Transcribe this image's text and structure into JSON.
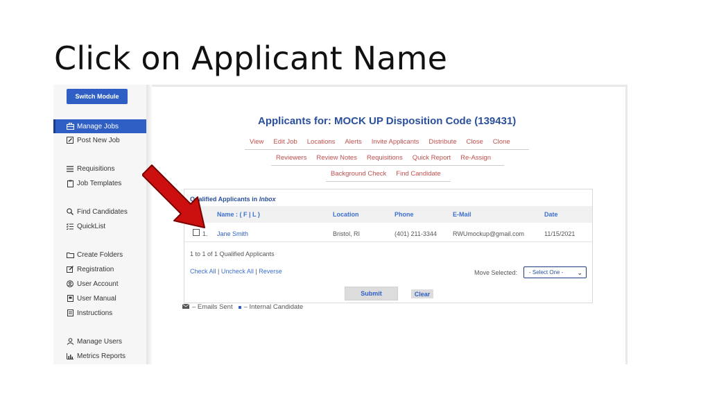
{
  "slide": {
    "title": "Click on Applicant Name"
  },
  "sidebar": {
    "switch_module": "Switch Module",
    "items": [
      {
        "label": "Manage Jobs",
        "icon": "briefcase-icon",
        "active": true
      },
      {
        "label": "Post New Job",
        "icon": "edit-icon",
        "active": false
      },
      {
        "label": "Requisitions",
        "icon": "list-icon",
        "active": false
      },
      {
        "label": "Job Templates",
        "icon": "clipboard-icon",
        "active": false
      },
      {
        "label": "Find Candidates",
        "icon": "search-icon",
        "active": false
      },
      {
        "label": "QuickList",
        "icon": "checklist-icon",
        "active": false
      },
      {
        "label": "Create Folders",
        "icon": "folder-icon",
        "active": false
      },
      {
        "label": "Registration",
        "icon": "edit-icon",
        "active": false
      },
      {
        "label": "User Account",
        "icon": "user-circle-icon",
        "active": false
      },
      {
        "label": "User Manual",
        "icon": "book-icon",
        "active": false
      },
      {
        "label": "Instructions",
        "icon": "document-icon",
        "active": false
      },
      {
        "label": "Manage Users",
        "icon": "users-icon",
        "active": false
      },
      {
        "label": "Metrics Reports",
        "icon": "bar-chart-icon",
        "active": false
      }
    ]
  },
  "header": {
    "title": "Applicants for: MOCK UP Disposition Code (139431)",
    "tabs_row1": [
      "View",
      "Edit Job",
      "Locations",
      "Alerts",
      "Invite Applicants",
      "Distribute",
      "Close",
      "Clone"
    ],
    "tabs_row2": [
      "Reviewers",
      "Review Notes",
      "Requisitions",
      "Quick Report",
      "Re-Assign"
    ],
    "tabs_row3": [
      "Background Check",
      "Find Candidate"
    ]
  },
  "panel": {
    "title_prefix": "Qualified Applicants in ",
    "title_folder": "Inbox",
    "columns": [
      "Name : ( F | L )",
      "Location",
      "Phone",
      "E-Mail",
      "Date"
    ],
    "rows": [
      {
        "num": "1.",
        "name": "Jane Smith",
        "location": "Bristol, RI",
        "phone": "(401) 211-3344",
        "email": "RWUmockup@gmail.com",
        "date": "11/15/2021"
      }
    ],
    "count_text": "1 to 1 of 1 Qualified Applicants",
    "check_all": "Check All",
    "uncheck_all": "Uncheck All",
    "reverse": "Reverse",
    "move_label": "Move Selected:",
    "move_select_value": "- Select One -",
    "submit": "Submit",
    "clear": "Clear"
  },
  "legend": {
    "emails_sent": "– Emails Sent",
    "internal": "– Internal Candidate"
  },
  "colors": {
    "primary": "#2f5fc4",
    "title_blue": "#2a4f9c",
    "tab_red": "#c0504d",
    "arrow_red": "#cc1010"
  }
}
